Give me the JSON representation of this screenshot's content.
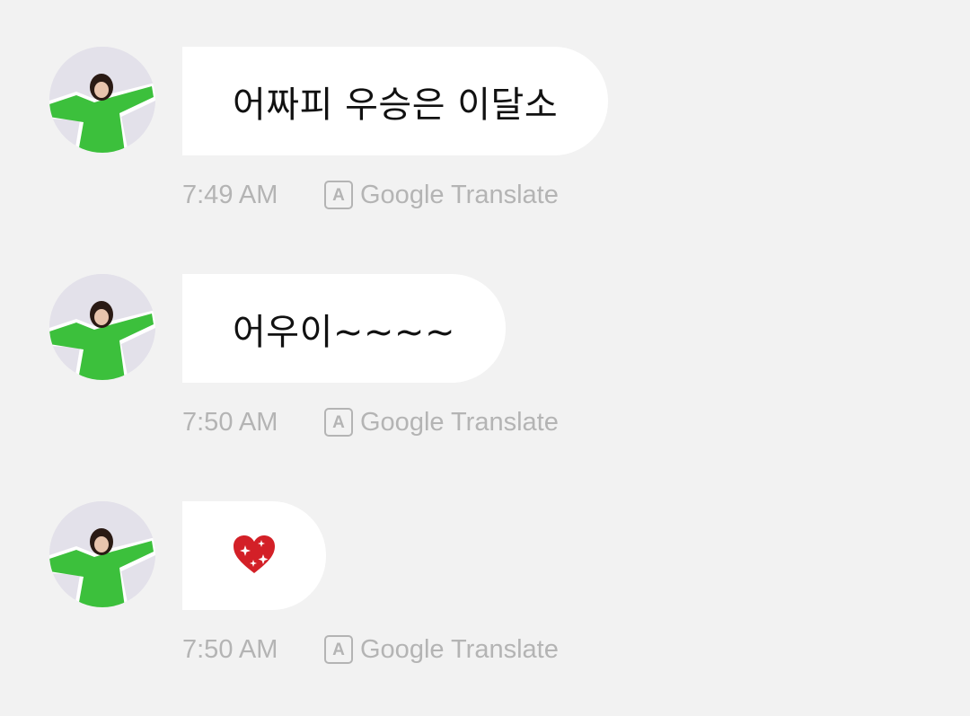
{
  "messages": [
    {
      "text": "어짜피 우승은 이달소",
      "time": "7:49 AM",
      "translate_label": "Google Translate",
      "translate_icon": "A"
    },
    {
      "text": "어우이~~~~",
      "time": "7:50 AM",
      "translate_label": "Google Translate",
      "translate_icon": "A"
    },
    {
      "text": "",
      "emoji": "sparkling-heart",
      "time": "7:50 AM",
      "translate_label": "Google Translate",
      "translate_icon": "A"
    }
  ],
  "colors": {
    "background": "#f2f2f2",
    "bubble": "#ffffff",
    "meta_text": "#b4b4b4",
    "heart": "#d32027",
    "avatar_green": "#3cc03c"
  }
}
